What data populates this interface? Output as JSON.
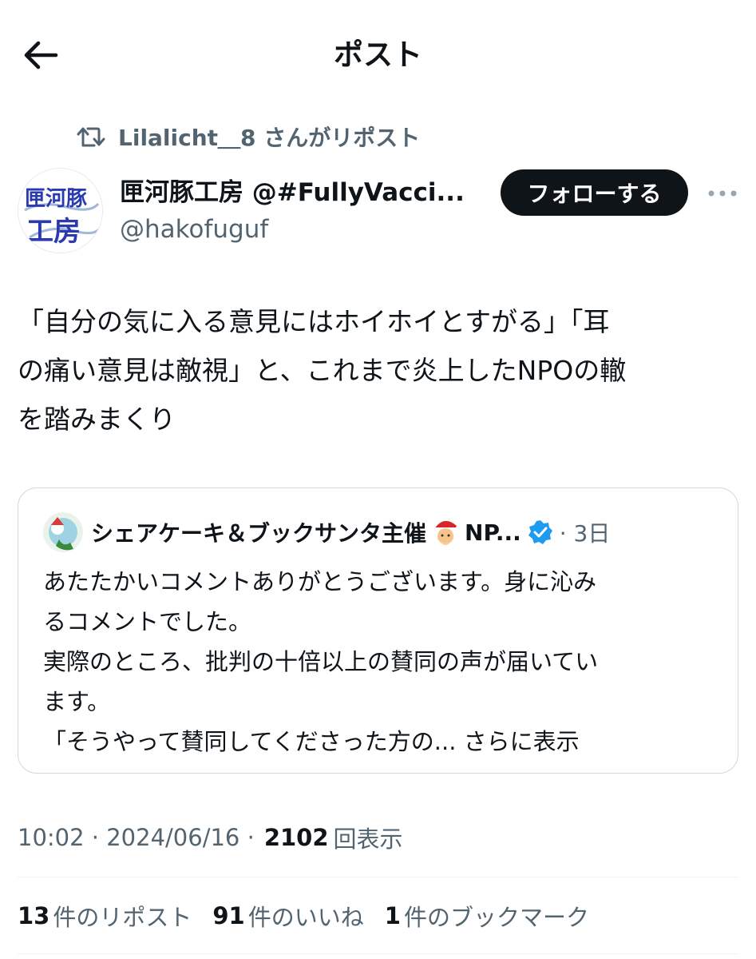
{
  "header": {
    "title": "ポスト"
  },
  "repost": {
    "text": "Lilalicht＿8 さんがリポスト"
  },
  "author": {
    "display_name": "匣河豚工房 @#FullyVacci...",
    "handle": "@hakofuguf",
    "avatar_text_1": "匣河豚",
    "avatar_text_2": "工房"
  },
  "follow_label": "フォローする",
  "tweet_text": "「自分の気に入る意見にはホイホイとすがる」「耳\nの痛い意見は敵視」と、これまで炎上したNPOの轍\nを踏みまくり",
  "quote": {
    "name": "シェアケーキ＆ブックサンタ主催",
    "name_tail": "NP...",
    "time": "· 3日",
    "text": "あたたかいコメントありがとうございます。身に沁み\nるコメントでした。\n実際のところ、批判の十倍以上の賛同の声が届いてい\nます。\n「そうやって賛同してくださった方の...",
    "show_more": " さらに表示"
  },
  "meta": {
    "time": "10:02 · 2024/06/16 ·",
    "views_count": "2102",
    "views_label": "回表示"
  },
  "stats": {
    "reposts_num": "13",
    "reposts_label": "件のリポスト",
    "likes_num": "91",
    "likes_label": "件のいいね",
    "bookmarks_num": "1",
    "bookmarks_label": "件のブックマーク"
  },
  "colors": {
    "text": "#0f1419",
    "secondary": "#536471",
    "border": "#cfd9de",
    "verified": "#1d9bf0"
  },
  "icons": [
    "back-arrow-icon",
    "repost-icon",
    "more-icon",
    "verified-badge-icon",
    "santa-emoji-icon"
  ]
}
